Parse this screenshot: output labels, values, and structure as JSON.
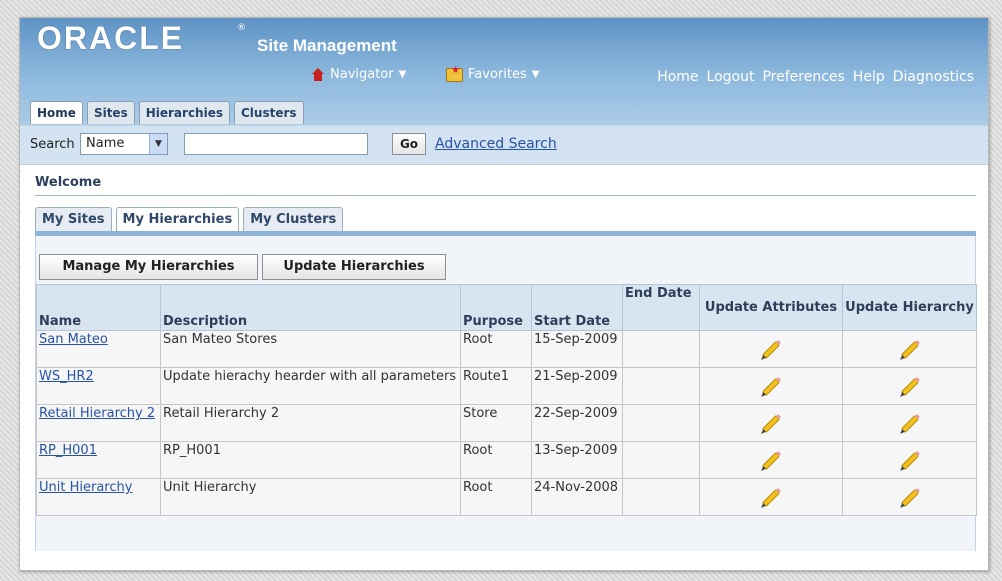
{
  "header": {
    "logo": "ORACLE",
    "logo_mark": "®",
    "app_title": "Site Management",
    "navigator": "Navigator",
    "favorites": "Favorites",
    "global_links": [
      "Home",
      "Logout",
      "Preferences",
      "Help",
      "Diagnostics"
    ]
  },
  "tabs": [
    {
      "label": "Home",
      "active": true
    },
    {
      "label": "Sites",
      "active": false
    },
    {
      "label": "Hierarchies",
      "active": false
    },
    {
      "label": "Clusters",
      "active": false
    }
  ],
  "search": {
    "label": "Search",
    "field": "Name",
    "value": "",
    "go_label": "Go",
    "advanced_label": "Advanced Search"
  },
  "welcome": "Welcome",
  "subtabs": [
    {
      "label": "My Sites",
      "active": false
    },
    {
      "label": "My Hierarchies",
      "active": true
    },
    {
      "label": "My Clusters",
      "active": false
    }
  ],
  "actions": {
    "manage": "Manage My Hierarchies",
    "update": "Update Hierarchies"
  },
  "table": {
    "headers": {
      "name": "Name",
      "description": "Description",
      "purpose": "Purpose",
      "start_date": "Start Date",
      "end_date": "End Date",
      "update_attributes": "Update Attributes",
      "update_hierarchy": "Update Hierarchy"
    },
    "rows": [
      {
        "name": "San Mateo",
        "description": "San Mateo Stores",
        "purpose": "Root",
        "start_date": "15-Sep-2009",
        "end_date": ""
      },
      {
        "name": "WS_HR2",
        "description": "Update hierachy hearder with all parameters",
        "purpose": "Route1",
        "start_date": "21-Sep-2009",
        "end_date": ""
      },
      {
        "name": "Retail Hierarchy 2",
        "description": "Retail Hierarchy 2",
        "purpose": "Store",
        "start_date": "22-Sep-2009",
        "end_date": ""
      },
      {
        "name": "RP_H001",
        "description": "RP_H001",
        "purpose": "Root",
        "start_date": "13-Sep-2009",
        "end_date": ""
      },
      {
        "name": "Unit Hierarchy",
        "description": "Unit Hierarchy",
        "purpose": "Root",
        "start_date": "24-Nov-2008",
        "end_date": ""
      }
    ]
  },
  "icons": {
    "home": "home-icon",
    "favorites": "favorites-icon",
    "edit": "pencil-icon"
  }
}
